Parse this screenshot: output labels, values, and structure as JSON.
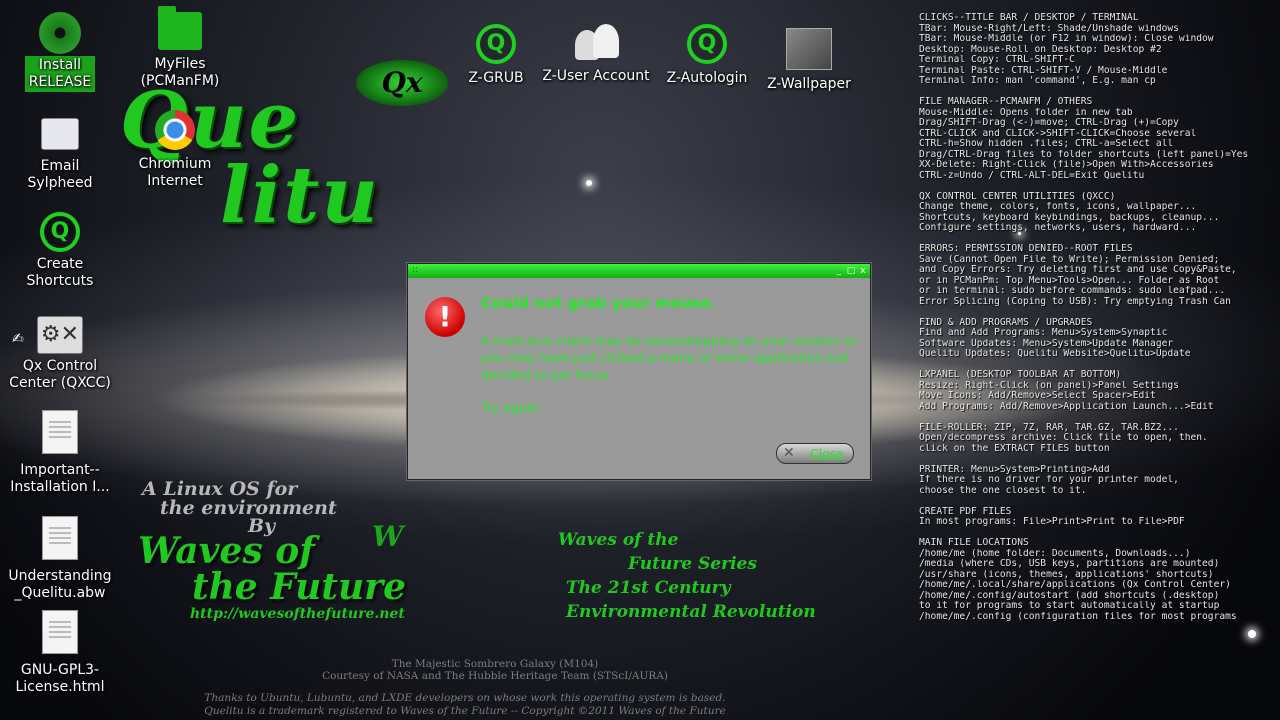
{
  "desktop_icons": [
    {
      "id": "install",
      "label": "Install\nRELEASE",
      "icon": "disc-icon"
    },
    {
      "id": "myfiles",
      "label": "MyFiles\n(PCManFM)",
      "icon": "folder-icon"
    },
    {
      "id": "email",
      "label": "Email\nSylpheed",
      "icon": "mail-icon"
    },
    {
      "id": "chromium",
      "label": "Chromium\nInternet",
      "icon": "chromium-icon"
    },
    {
      "id": "shortcuts",
      "label": "Create\nShortcuts",
      "icon": "q-logo-icon"
    },
    {
      "id": "qxcc",
      "label": "Qx Control\nCenter (QXCC)",
      "icon": "tools-icon"
    },
    {
      "id": "important",
      "label": "Important--\nInstallation I...",
      "icon": "document-icon"
    },
    {
      "id": "understanding",
      "label": "Understanding\n_Quelitu.abw",
      "icon": "document-icon"
    },
    {
      "id": "gpl",
      "label": "GNU-GPL3-\nLicense.html",
      "icon": "html-file-icon"
    },
    {
      "id": "zgrub",
      "label": "Z-GRUB",
      "icon": "q-logo-icon"
    },
    {
      "id": "zuser",
      "label": "Z-User Account",
      "icon": "users-icon"
    },
    {
      "id": "zautologin",
      "label": "Z-Autologin",
      "icon": "q-logo-icon"
    },
    {
      "id": "zwallpaper",
      "label": "Z-Wallpaper",
      "icon": "wallpaper-icon"
    }
  ],
  "logo": {
    "qx": "Qx",
    "line1": "Que",
    "line2": "litu"
  },
  "wallpaper_text": {
    "tag1": "A Linux OS for",
    "tag2": "the environment",
    "by": "By",
    "waves1": "Waves of",
    "waves2": "the Future",
    "url": "http://wavesofthefuture.net",
    "w": "W",
    "series1": "Waves of the",
    "series2": "Future Series",
    "series3": "The 21st Century",
    "series4": "Environmental Revolution",
    "credit1": "The Majestic Sombrero Galaxy (M104)",
    "credit2": "Courtesy of NASA and The Hubble Heritage Team (STScI/AURA)",
    "credit3": "Thanks to Ubuntu, Lubuntu, and LXDE developers on whose work this operating system is based.",
    "credit4": "Quelitu is a trademark registered to Waves of the Future -- Copyright ©2011 Waves of the Future"
  },
  "help_sections": [
    [
      "CLICKS--TITLE BAR / DESKTOP / TERMINAL",
      "TBar: Mouse-Right/Left: Shade/Unshade windows",
      "TBar: Mouse-Middle (or F12 in window): Close window",
      "Desktop: Mouse-Roll on Desktop: Desktop #2",
      "Terminal Copy: CTRL-SHIFT-C",
      "Terminal Paste: CTRL-SHIFT-V / Mouse-Middle",
      "Terminal Info: man 'command', E.g. man cp"
    ],
    [
      "FILE MANAGER--PCMANFM / OTHERS",
      "Mouse-Middle: Opens folder in new tab",
      "Drag/SHIFT-Drag (<-)=move; CTRL-Drag (+)=Copy",
      "CTRL-CLICK and CLICK->SHIFT-CLICK=Choose several",
      "CTRL-h=Show hidden .files; CTRL-a=Select all",
      "Drag/CTRL-Drag files to folder shortcuts (left panel)=Yes",
      "XX-Delete: Right-Click (file)>Open With>Accessories",
      "CTRL-z=Undo / CTRL-ALT-DEL=Exit Quelitu"
    ],
    [
      "QX CONTROL CENTER UTILITIES (QXCC)",
      "Change theme, colors, fonts, icons, wallpaper...",
      "Shortcuts, keyboard keybindings, backups, cleanup...",
      "Configure settings, networks, users, hardward..."
    ],
    [
      "ERRORS: PERMISSION DENIED--ROOT FILES",
      "Save (Cannot Open File to Write); Permission Denied;",
      "and Copy Errors: Try deleting first and use Copy&Paste,",
      "or in PCManPm: Top Menu>Tools>Open... Folder as Root",
      "or in terminal: sudo before commands: sudo leafpad...",
      "Error Splicing (Coping to USB): Try emptying Trash Can"
    ],
    [
      "FIND & ADD PROGRAMS / UPGRADES",
      "Find and Add Programs: Menu>System>Synaptic",
      "Software Updates: Menu>System>Update Manager",
      "Quelitu Updates: Quelitu Website>Quelitu>Update"
    ],
    [
      "LXPANEL (DESKTOP TOOLBAR AT BOTTOM)",
      "Resize: Right-Click (on panel)>Panel Settings",
      "Move Icons: Add/Remove>Select Spacer>Edit",
      "Add Programs: Add/Remove>Application Launch...>Edit"
    ],
    [
      "FILE-ROLLER: ZIP, 7Z, RAR, TAR.GZ, TAR.BZ2...",
      "Open/decompress archive: Click file to open, then.",
      "click on the EXTRACT FILES button"
    ],
    [
      "PRINTER: Menu>System>Printing>Add",
      "If there is no driver for your printer model,",
      "choose the one closest to it."
    ],
    [
      "CREATE PDF FILES",
      "In most programs: File>Print>Print to File>PDF"
    ],
    [
      "MAIN FILE LOCATIONS",
      "/home/me (home folder: Documents, Downloads...)",
      "/media (where CDs, USB keys, partitions are mounted)",
      "/usr/share (icons, themes, applications' shortcuts)",
      "/home/me/.local/share/applications (Qx Control Center)",
      "/home/me/.config/autostart (add shortcuts (.desktop)",
      "to it for programs to start automatically at startup",
      "/home/me/.config (configuration files for most programs"
    ]
  ],
  "dialog": {
    "title": "Could not grab your mouse.",
    "message": "A malicious client may be eavesdropping on your session or you may have just clicked a menu or some application just decided to get focus.",
    "retry": "Try again.",
    "close_label": "Close",
    "titlebar_grip": "::",
    "min_glyph": "_",
    "max_glyph": "□",
    "close_glyph": "x",
    "error_glyph": "!"
  },
  "colors": {
    "accent": "#20c820",
    "dialog_bg": "#9a9a9a",
    "dialog_text": "#29e629"
  }
}
